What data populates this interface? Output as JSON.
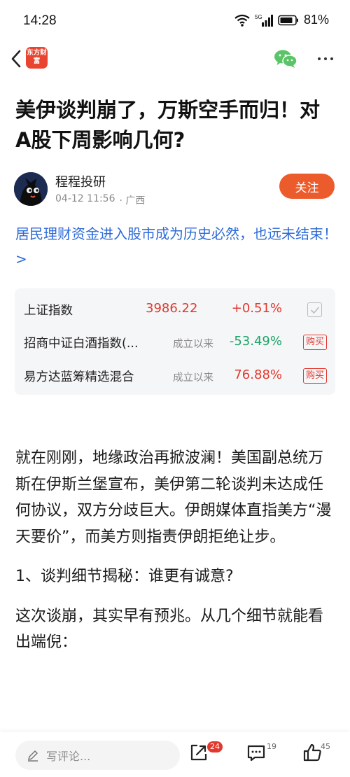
{
  "status_bar": {
    "time": "14:28",
    "battery": "81%",
    "network": "5G"
  },
  "nav": {
    "logo_text": "东方财富"
  },
  "article": {
    "title": "美伊谈判崩了，万斯空手而归！对A股下周影响几何?",
    "author": {
      "name": "程程投研",
      "date": "04-12 11:56",
      "location": "· 广西",
      "follow_label": "关注"
    },
    "promo_link": "居民理财资金进入股市成为历史必然，也远未结束！ >",
    "funds": [
      {
        "name": "上证指数",
        "value": "3986.22",
        "change": "+0.51%",
        "direction": "up",
        "action": "checkbox"
      },
      {
        "name": "招商中证白酒指数(...",
        "tag": "成立以来",
        "change": "-53.49%",
        "direction": "down",
        "action_label": "购买"
      },
      {
        "name": "易方达蓝筹精选混合",
        "tag": "成立以来",
        "change": "76.88%",
        "direction": "up",
        "action_label": "购买"
      }
    ],
    "paragraphs": [
      "就在刚刚，地缘政治再掀波澜！美国副总统万斯在伊斯兰堡宣布，美伊第二轮谈判未达成任何协议，双方分歧巨大。伊朗媒体直指美方“漫天要价”，而美方则指责伊朗拒绝让步。",
      "1、谈判细节揭秘：谁更有诚意?",
      "这次谈崩，其实早有预兆。从几个细节就能看出端倪："
    ]
  },
  "bottom_bar": {
    "comment_placeholder": "写评论...",
    "share_count": "24",
    "comment_count": "19",
    "like_count": "45"
  },
  "colors": {
    "accent": "#ec5b2b",
    "up": "#e2382d",
    "down": "#1ea36b",
    "link": "#2e6bd8"
  },
  "icons": [
    "wifi-icon",
    "signal-icon",
    "battery-icon",
    "back-arrow-icon",
    "wechat-icon",
    "more-icon",
    "pencil-icon",
    "share-icon",
    "comment-icon",
    "like-icon",
    "check-icon"
  ]
}
